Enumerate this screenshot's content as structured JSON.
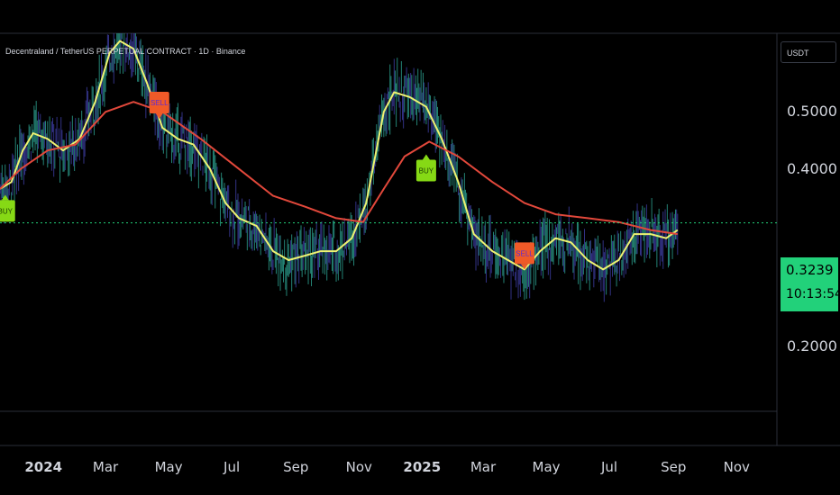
{
  "header": {
    "title": "Decentraland / TetherUS PERPETUAL CONTRACT · 1D · Binance",
    "currency": "USDT"
  },
  "price_label": {
    "price": "0.3239",
    "countdown": "10:13:54"
  },
  "colors": {
    "background": "#000000",
    "fast_ma": "#eef272",
    "slow_ma": "#e2483b",
    "candles": "#2a9a8a",
    "candles_alt": "#3b3b9b",
    "buy_signal": "#86d915",
    "sell_signal": "#f05a28",
    "current_price": "#22d17a"
  },
  "chart_data": {
    "type": "line",
    "title": "Decentraland / TetherUS PERPETUAL CONTRACT · 1D · Binance",
    "y_scale": "log",
    "ylim": [
      0.155,
      0.68
    ],
    "xlim": [
      "2023-11-20",
      "2025-12-10"
    ],
    "y_ticks": [
      "0.5000",
      "0.4000",
      "0.2000"
    ],
    "x_ticks": [
      "2024",
      "Mar",
      "May",
      "Jul",
      "Sep",
      "Nov",
      "2025",
      "Mar",
      "May",
      "Jul",
      "Sep",
      "Nov"
    ],
    "x_tick_dates": [
      "2024-01-01",
      "2024-03-01",
      "2024-05-01",
      "2024-07-01",
      "2024-09-01",
      "2024-11-01",
      "2025-01-01",
      "2025-03-01",
      "2025-05-01",
      "2025-07-01",
      "2025-09-01",
      "2025-11-01"
    ],
    "current_price": 0.3239,
    "series": [
      {
        "name": "",
        "color": "#eef272",
        "points": [
          [
            "2023-11-20",
            0.37
          ],
          [
            "2023-12-01",
            0.38
          ],
          [
            "2023-12-12",
            0.43
          ],
          [
            "2023-12-22",
            0.46
          ],
          [
            "2024-01-05",
            0.45
          ],
          [
            "2024-01-20",
            0.43
          ],
          [
            "2024-02-05",
            0.45
          ],
          [
            "2024-02-20",
            0.52
          ],
          [
            "2024-03-05",
            0.63
          ],
          [
            "2024-03-15",
            0.66
          ],
          [
            "2024-03-28",
            0.64
          ],
          [
            "2024-04-10",
            0.56
          ],
          [
            "2024-04-25",
            0.47
          ],
          [
            "2024-05-10",
            0.45
          ],
          [
            "2024-05-25",
            0.44
          ],
          [
            "2024-06-10",
            0.4
          ],
          [
            "2024-06-25",
            0.35
          ],
          [
            "2024-07-08",
            0.33
          ],
          [
            "2024-07-25",
            0.32
          ],
          [
            "2024-08-10",
            0.29
          ],
          [
            "2024-08-25",
            0.28
          ],
          [
            "2024-09-10",
            0.285
          ],
          [
            "2024-09-25",
            0.29
          ],
          [
            "2024-10-10",
            0.29
          ],
          [
            "2024-10-25",
            0.305
          ],
          [
            "2024-11-08",
            0.35
          ],
          [
            "2024-11-25",
            0.5
          ],
          [
            "2024-12-05",
            0.54
          ],
          [
            "2024-12-20",
            0.53
          ],
          [
            "2025-01-05",
            0.51
          ],
          [
            "2025-01-20",
            0.45
          ],
          [
            "2025-02-05",
            0.38
          ],
          [
            "2025-02-20",
            0.31
          ],
          [
            "2025-03-10",
            0.29
          ],
          [
            "2025-03-25",
            0.28
          ],
          [
            "2025-04-10",
            0.27
          ],
          [
            "2025-04-25",
            0.29
          ],
          [
            "2025-05-10",
            0.305
          ],
          [
            "2025-05-25",
            0.3
          ],
          [
            "2025-06-10",
            0.28
          ],
          [
            "2025-06-25",
            0.27
          ],
          [
            "2025-07-10",
            0.28
          ],
          [
            "2025-07-25",
            0.31
          ],
          [
            "2025-08-10",
            0.31
          ],
          [
            "2025-08-25",
            0.305
          ],
          [
            "2025-09-05",
            0.315
          ]
        ]
      },
      {
        "name": "",
        "color": "#e2483b",
        "points": [
          [
            "2023-11-20",
            0.37
          ],
          [
            "2023-12-10",
            0.4
          ],
          [
            "2024-01-05",
            0.43
          ],
          [
            "2024-02-01",
            0.44
          ],
          [
            "2024-03-01",
            0.5
          ],
          [
            "2024-03-28",
            0.52
          ],
          [
            "2024-04-25",
            0.5
          ],
          [
            "2024-06-01",
            0.45
          ],
          [
            "2024-07-08",
            0.4
          ],
          [
            "2024-08-10",
            0.36
          ],
          [
            "2024-09-10",
            0.345
          ],
          [
            "2024-10-10",
            0.33
          ],
          [
            "2024-11-05",
            0.325
          ],
          [
            "2024-11-25",
            0.37
          ],
          [
            "2024-12-15",
            0.42
          ],
          [
            "2025-01-08",
            0.445
          ],
          [
            "2025-02-05",
            0.42
          ],
          [
            "2025-03-10",
            0.38
          ],
          [
            "2025-04-10",
            0.35
          ],
          [
            "2025-05-10",
            0.335
          ],
          [
            "2025-06-10",
            0.33
          ],
          [
            "2025-07-10",
            0.325
          ],
          [
            "2025-08-10",
            0.315
          ],
          [
            "2025-09-05",
            0.31
          ]
        ]
      }
    ],
    "signals": [
      {
        "label": "BUY",
        "date": "2023-11-25",
        "type": "buy"
      },
      {
        "label": "SELL",
        "date": "2024-04-22",
        "type": "sell"
      },
      {
        "label": "BUY",
        "date": "2025-01-05",
        "type": "buy"
      },
      {
        "label": "SELL",
        "date": "2025-04-10",
        "type": "sell"
      }
    ]
  }
}
